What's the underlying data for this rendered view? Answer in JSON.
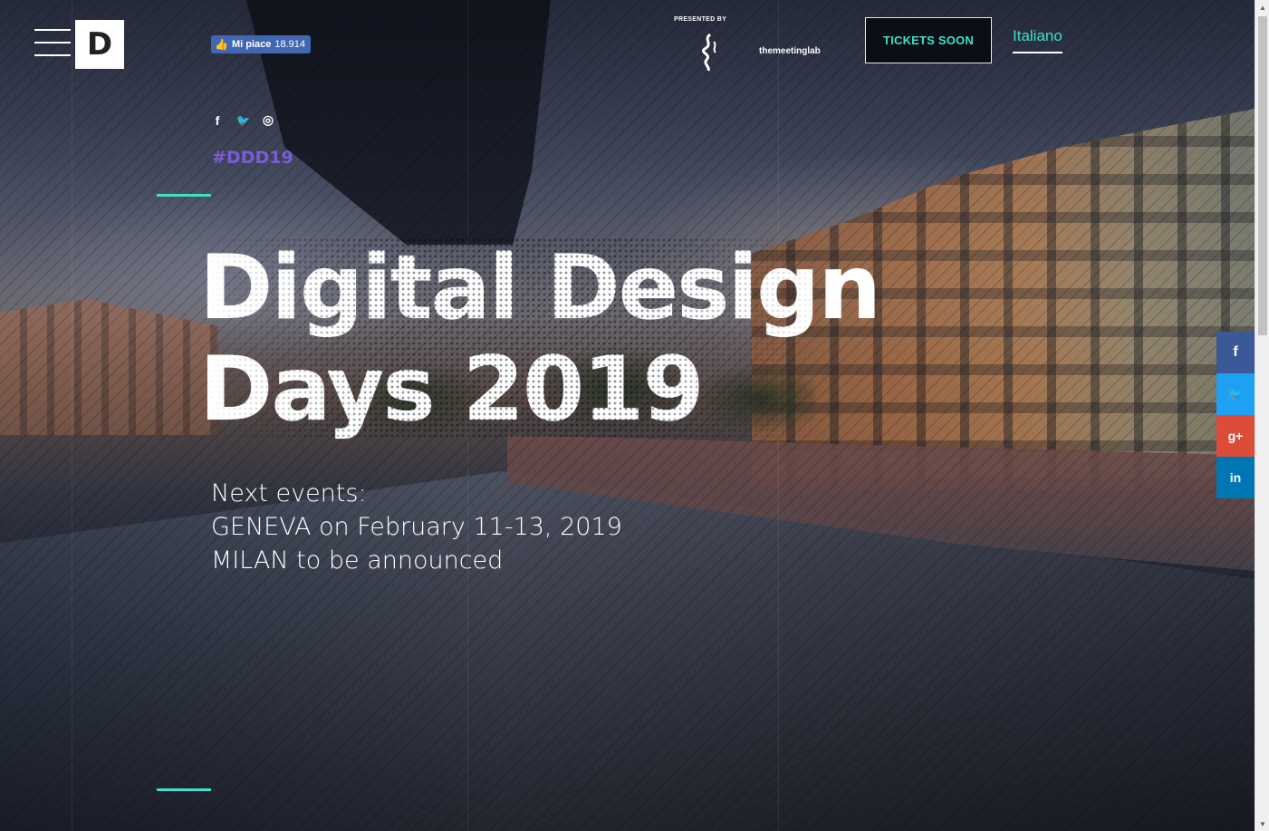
{
  "header": {
    "logo_letter": "D",
    "fb_like": {
      "label": "Mi piace",
      "count": "18.914"
    },
    "presented_by": "PRESENTED BY",
    "partner_name": "themeetinglab",
    "tickets_label": "TICKETS SOON",
    "language_label": "Italiano"
  },
  "social_small": [
    {
      "icon": "facebook-icon",
      "glyph": "f"
    },
    {
      "icon": "twitter-icon",
      "glyph": "🐦"
    },
    {
      "icon": "instagram-icon",
      "glyph": "◎"
    }
  ],
  "hashtag": "#DDD19",
  "hero": {
    "title_line1": "Digital Design",
    "title_line2": "Days 2019"
  },
  "next_events": {
    "heading": "Next events:",
    "line1": "GENEVA on February 11-13, 2019",
    "line2": "MILAN to be announced"
  },
  "share_bar": [
    {
      "icon": "facebook-icon",
      "glyph": "f",
      "color": "#3b5998"
    },
    {
      "icon": "twitter-icon",
      "glyph": "🐦",
      "color": "#1da1f2"
    },
    {
      "icon": "google-plus-icon",
      "glyph": "g+",
      "color": "#dd4b39"
    },
    {
      "icon": "linkedin-icon",
      "glyph": "in",
      "color": "#0077b5"
    }
  ],
  "colors": {
    "accent": "#3ee0c6",
    "hashtag": "#7b5cd6"
  }
}
